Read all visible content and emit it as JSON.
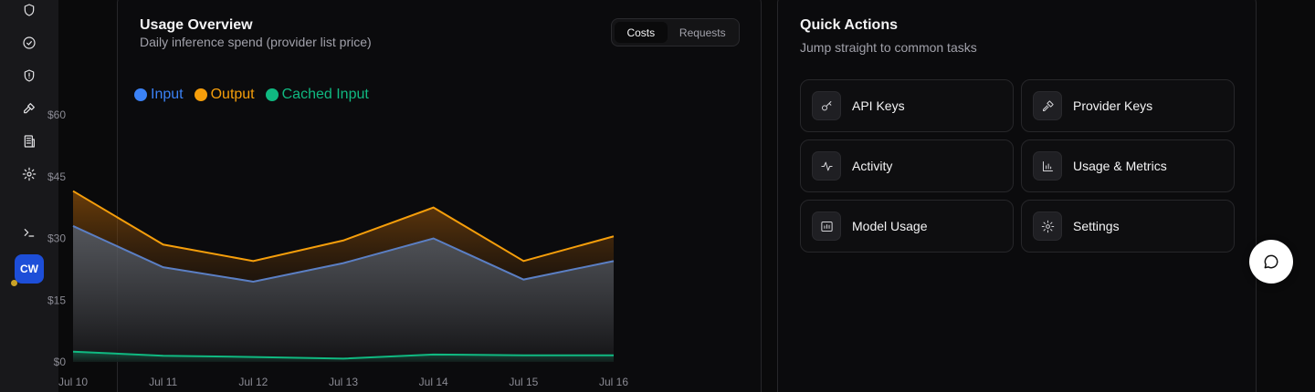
{
  "sidebar": {
    "icons": [
      "shield-icon",
      "check-circle-icon",
      "shield-alert-icon",
      "key-icon",
      "building-icon",
      "gear-icon",
      "terminal-icon"
    ],
    "avatar_initials": "CW"
  },
  "usage": {
    "title": "Usage Overview",
    "subtitle": "Daily inference spend (provider list price)",
    "toggle": {
      "active": "Costs",
      "inactive": "Requests"
    }
  },
  "chart_data": {
    "type": "area",
    "categories": [
      "Jul 10",
      "Jul 11",
      "Jul 12",
      "Jul 13",
      "Jul 14",
      "Jul 15",
      "Jul 16"
    ],
    "series": [
      {
        "name": "Input",
        "color": "#3b82f6",
        "values": [
          33,
          23,
          19.5,
          24,
          30,
          20,
          24.5
        ]
      },
      {
        "name": "Output",
        "color": "#f59e0b",
        "values": [
          41.5,
          28.5,
          24.5,
          29.5,
          37.5,
          24.5,
          30.5
        ]
      },
      {
        "name": "Cached Input",
        "color": "#10b981",
        "values": [
          2.5,
          1.5,
          1.2,
          0.8,
          1.8,
          1.6,
          1.6
        ]
      }
    ],
    "yticks": [
      "$0",
      "$15",
      "$30",
      "$45",
      "$60"
    ],
    "ylim": [
      0,
      60
    ],
    "legend": "top-left",
    "grid": false
  },
  "quick_actions": {
    "title": "Quick Actions",
    "subtitle": "Jump straight to common tasks",
    "items": [
      {
        "label": "API Keys",
        "icon": "key-icon"
      },
      {
        "label": "Provider Keys",
        "icon": "wrench-key-icon"
      },
      {
        "label": "Activity",
        "icon": "activity-icon"
      },
      {
        "label": "Usage & Metrics",
        "icon": "bar-chart-icon"
      },
      {
        "label": "Model Usage",
        "icon": "model-usage-icon"
      },
      {
        "label": "Settings",
        "icon": "gear-icon"
      }
    ]
  }
}
